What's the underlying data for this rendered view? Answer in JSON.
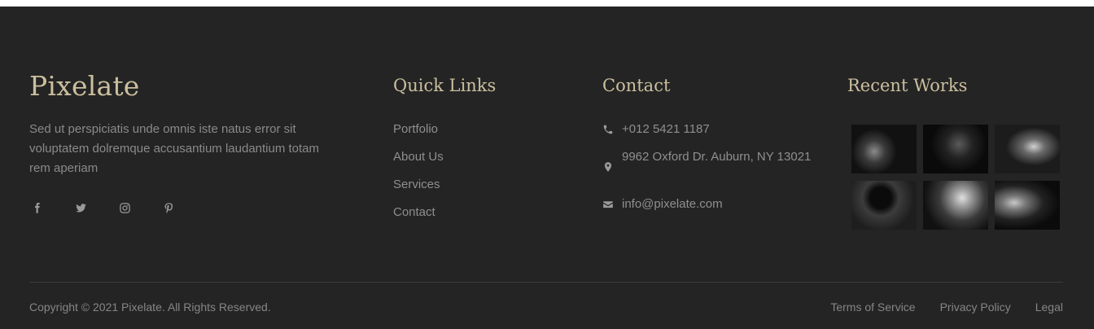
{
  "brand": {
    "name": "Pixelate",
    "about": "Sed ut perspiciatis unde omnis iste natus error sit voluptatem dolremque accusantium laudantium totam rem aperiam"
  },
  "social": [
    "facebook-icon",
    "twitter-icon",
    "instagram-icon",
    "pinterest-icon"
  ],
  "quick_links": {
    "title": "Quick Links",
    "items": [
      "Portfolio",
      "About Us",
      "Services",
      "Contact"
    ]
  },
  "contact": {
    "title": "Contact",
    "phone": "+012 5421 1187",
    "address": "9962 Oxford Dr. Auburn, NY 13021",
    "email": "info@pixelate.com"
  },
  "recent_works": {
    "title": "Recent Works"
  },
  "bottom": {
    "copyright": "Copyright © 2021 Pixelate. All Rights Reserved.",
    "links": [
      "Terms of Service",
      "Privacy Policy",
      "Legal"
    ]
  },
  "colors": {
    "background": "#242424",
    "accent": "#cbbf9f",
    "text": "#8f8f8f"
  }
}
